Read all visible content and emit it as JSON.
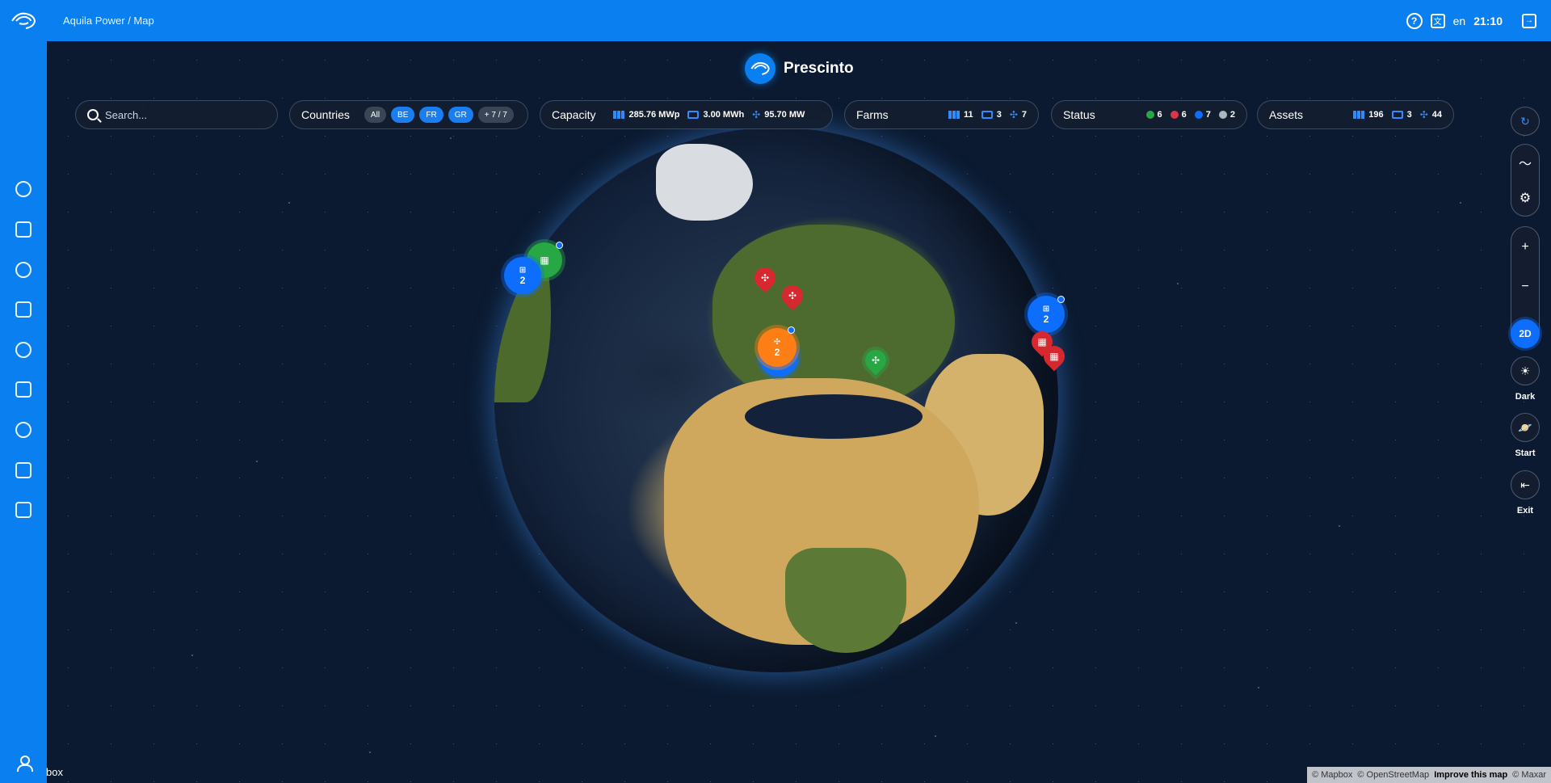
{
  "header": {
    "breadcrumb": "Aquila Power / Map",
    "language": "en",
    "time": "21:10"
  },
  "brand": {
    "name": "Prescinto"
  },
  "search": {
    "placeholder": "Search..."
  },
  "countries": {
    "label": "Countries",
    "chips": [
      "All",
      "BE",
      "FR",
      "GR"
    ],
    "more": "+ 7 / 7"
  },
  "capacity": {
    "label": "Capacity",
    "solar": "285.76 MWp",
    "battery": "3.00 MWh",
    "wind": "95.70 MW"
  },
  "farms": {
    "label": "Farms",
    "solar": "11",
    "battery": "3",
    "wind": "7"
  },
  "status": {
    "label": "Status",
    "ok": "6",
    "critical": "6",
    "info": "7",
    "unknown": "2"
  },
  "assets": {
    "label": "Assets",
    "solar": "196",
    "battery": "3",
    "wind": "44"
  },
  "markers": {
    "cluster_us": "2",
    "cluster_spain": "2",
    "cluster_east": "2"
  },
  "rail": {
    "mode_label": "2D",
    "theme_label": "Dark",
    "start_label": "Start",
    "exit_label": "Exit"
  },
  "footer": {
    "box_text": "box",
    "mapbox": "© Mapbox",
    "osm": "© OpenStreetMap",
    "improve": "Improve this map",
    "maxar": "© Maxar"
  },
  "colors": {
    "brand_blue": "#0a7ff0",
    "status_ok": "#28a745",
    "status_critical": "#dc3545",
    "status_info": "#0d6efd",
    "status_unknown": "#adb5bd"
  }
}
